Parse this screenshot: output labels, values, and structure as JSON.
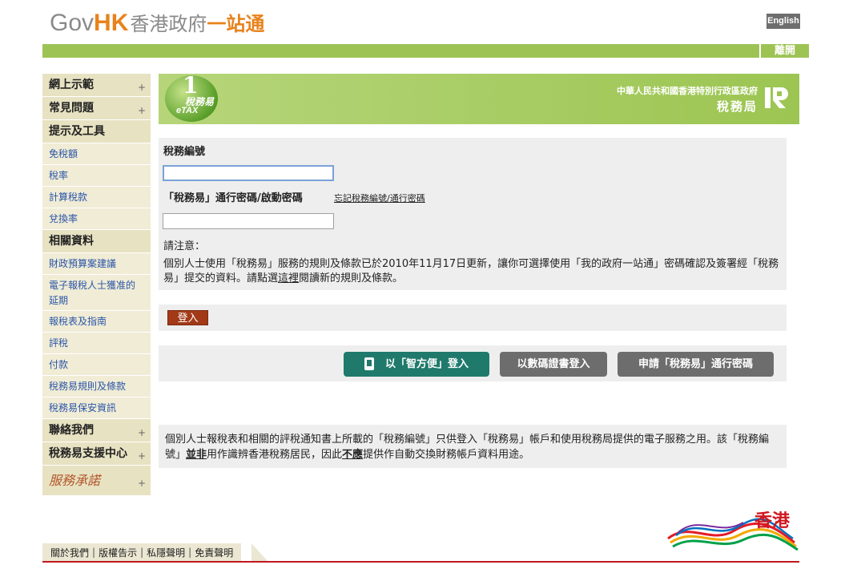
{
  "header": {
    "logo_gov": "Gov",
    "logo_hk": "HK",
    "logo_cn": "香港政府",
    "logo_cn2": "一站通",
    "lang_button": "English",
    "exit_button": "離開"
  },
  "sidebar": {
    "items": [
      {
        "label": "網上示範",
        "type": "head",
        "expand": true
      },
      {
        "label": "常見問題",
        "type": "head",
        "expand": true
      },
      {
        "label": "提示及工具",
        "type": "head",
        "expand": false
      },
      {
        "label": "免稅額",
        "type": "link"
      },
      {
        "label": "稅率",
        "type": "link"
      },
      {
        "label": "計算稅款",
        "type": "link"
      },
      {
        "label": "兌換率",
        "type": "link"
      },
      {
        "label": "相關資料",
        "type": "head",
        "expand": false
      },
      {
        "label": "財政預算案建議",
        "type": "link"
      },
      {
        "label": "電子報稅人士獲准的延期",
        "type": "link-tall"
      },
      {
        "label": "報稅表及指南",
        "type": "link"
      },
      {
        "label": "評稅",
        "type": "link"
      },
      {
        "label": "付款",
        "type": "link"
      },
      {
        "label": "稅務易規則及條款",
        "type": "link"
      },
      {
        "label": "稅務易保安資訊",
        "type": "link"
      },
      {
        "label": "聯絡我們",
        "type": "head",
        "expand": true
      },
      {
        "label": "稅務易支援中心",
        "type": "head",
        "expand": true
      }
    ],
    "brand_label": "服務承諾",
    "plus_glyph": "+"
  },
  "banner": {
    "etax_one": "1",
    "etax_cn": "稅務易",
    "etax_en": "eTAX",
    "dept_line1": "中華人民共和國香港特別行政區政府",
    "dept_line2": "稅務局"
  },
  "form": {
    "tax_id_label": "稅務編號",
    "tax_id_value": "",
    "password_label": "「稅務易」通行密碼/啟動密碼",
    "forgot_link": "忘記稅務編號/通行密碼",
    "password_value": "",
    "note_label": "請注意：",
    "notice_part1": "個別人士使用「稅務易」服務的規則及條款已於2010年11月17日更新，讓你可選擇使用「我的政府一站通」密碼確認及簽署經「稅務易」提交的資料。請點選",
    "notice_link": "這裡",
    "notice_part2": "閱讀新的規則及條款。",
    "login_button": "登入"
  },
  "alt_login": {
    "iamsmart_button": "以「智方便」登入",
    "cert_button": "以數碼證書登入",
    "apply_button": "申請「稅務易」通行密碼"
  },
  "info": {
    "part1": "個別人士報稅表和相關的評稅通知書上所載的「稅務編號」只供登入「稅務易」帳戶和使用稅務局提供的電子服務之用。該「稅務編號」",
    "bold1": "並非",
    "part2": "用作識辨香港稅務居民，因此",
    "bold2": "不應",
    "part3": "提供作自動交換財務帳戶資料用途。"
  },
  "brand_hk": "香港",
  "footer": {
    "links": [
      "關於我們",
      "版權告示",
      "私隱聲明",
      "免責聲明"
    ],
    "separator": "|"
  }
}
